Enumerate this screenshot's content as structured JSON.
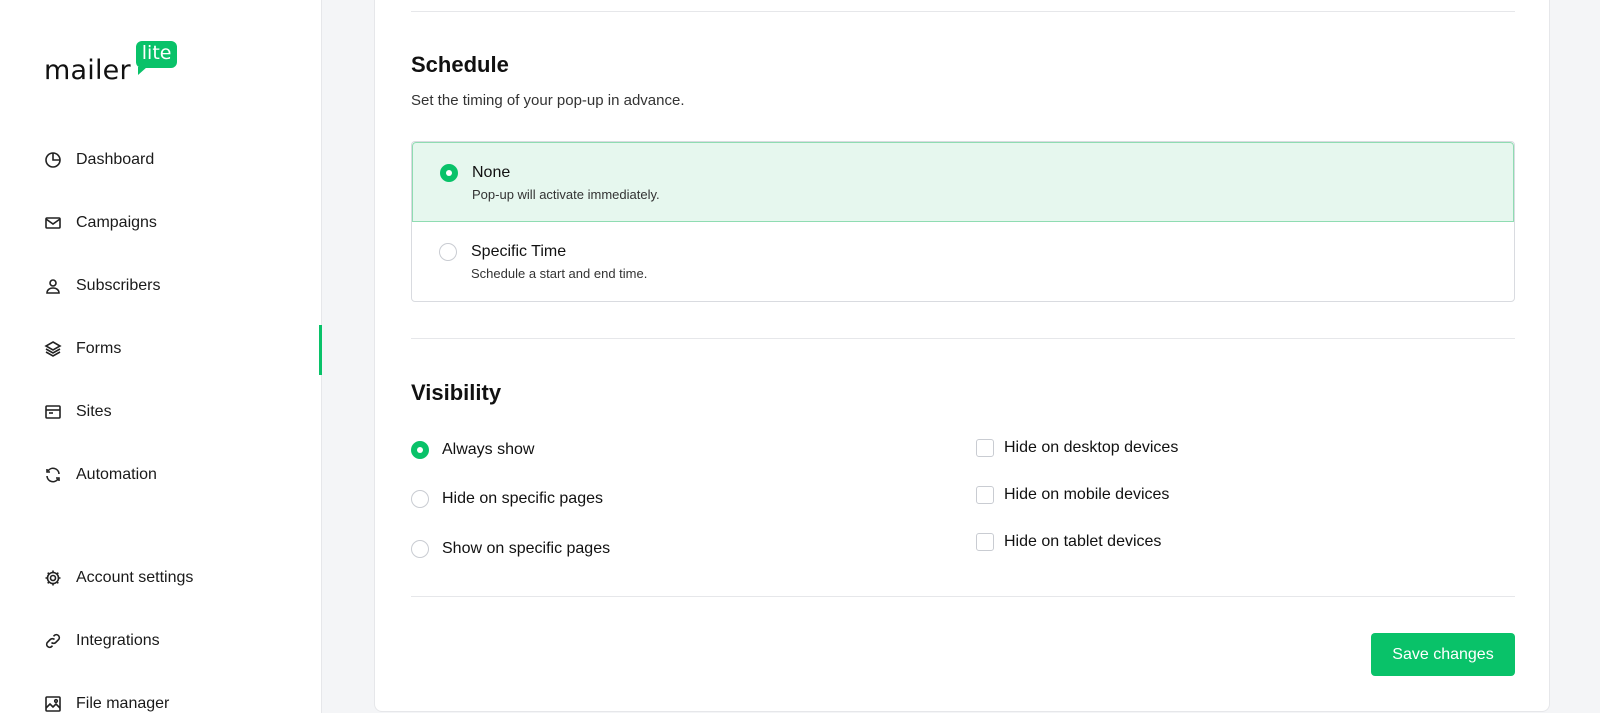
{
  "brand": {
    "word": "mailer",
    "badge": "lite",
    "accent": "#09c269"
  },
  "sidebar": {
    "items": [
      {
        "label": "Dashboard",
        "icon": "pie-chart-icon"
      },
      {
        "label": "Campaigns",
        "icon": "mail-icon"
      },
      {
        "label": "Subscribers",
        "icon": "user-icon"
      },
      {
        "label": "Forms",
        "icon": "layers-icon",
        "active": true
      },
      {
        "label": "Sites",
        "icon": "browser-icon"
      },
      {
        "label": "Automation",
        "icon": "refresh-icon"
      },
      {
        "label": "Account settings",
        "icon": "gear-icon"
      },
      {
        "label": "Integrations",
        "icon": "link-icon"
      },
      {
        "label": "File manager",
        "icon": "image-icon"
      }
    ]
  },
  "schedule": {
    "title": "Schedule",
    "subtitle": "Set the timing of your pop-up in advance.",
    "options": [
      {
        "title": "None",
        "desc": "Pop-up will activate immediately.",
        "selected": true
      },
      {
        "title": "Specific Time",
        "desc": "Schedule a start and end time.",
        "selected": false
      }
    ]
  },
  "visibility": {
    "title": "Visibility",
    "radios": [
      {
        "label": "Always show",
        "selected": true
      },
      {
        "label": "Hide on specific pages",
        "selected": false
      },
      {
        "label": "Show on specific pages",
        "selected": false
      }
    ],
    "checkboxes": [
      {
        "label": "Hide on desktop devices",
        "checked": false
      },
      {
        "label": "Hide on mobile devices",
        "checked": false
      },
      {
        "label": "Hide on tablet devices",
        "checked": false
      }
    ]
  },
  "actions": {
    "save_label": "Save changes"
  }
}
